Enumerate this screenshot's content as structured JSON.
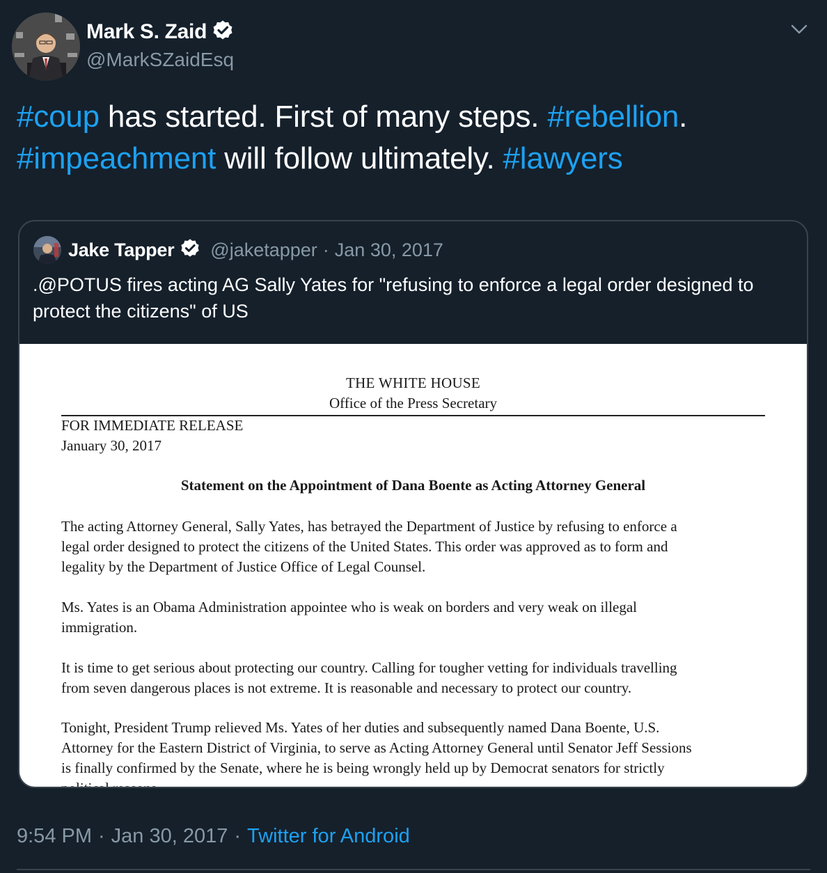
{
  "author": {
    "name": "Mark S. Zaid",
    "handle": "@MarkSZaidEsq"
  },
  "tweet": {
    "segments": [
      {
        "text": "#coup",
        "type": "hashtag"
      },
      {
        "text": " has started. First of many steps. ",
        "type": "text"
      },
      {
        "text": "#rebellion",
        "type": "hashtag"
      },
      {
        "text": ".\n",
        "type": "text"
      },
      {
        "text": "#impeachment",
        "type": "hashtag"
      },
      {
        "text": " will follow ultimately. ",
        "type": "text"
      },
      {
        "text": "#lawyers",
        "type": "hashtag"
      }
    ]
  },
  "quote": {
    "name": "Jake Tapper",
    "handle": "@jaketapper",
    "separator": "·",
    "date": "Jan 30, 2017",
    "text": ".@POTUS fires acting AG Sally Yates  for \"refusing to enforce a legal order designed to protect the citizens\" of US",
    "document": {
      "header_1": "THE WHITE HOUSE",
      "header_2": "Office of the Press Secretary",
      "release": "FOR IMMEDIATE RELEASE",
      "date": "January 30, 2017",
      "title": "Statement on the Appointment of Dana Boente as Acting Attorney General",
      "p1_lines": [
        "The acting Attorney General, Sally Yates, has betrayed the Department of Justice by refusing to enforce a",
        "legal order designed to protect the citizens of the United States. This order was approved as to form and",
        "legality by the Department of Justice Office of Legal Counsel."
      ],
      "p2_lines": [
        "Ms. Yates is an Obama Administration appointee who is weak on borders and very weak on illegal",
        "immigration."
      ],
      "p3_lines": [
        "It is time to get serious about protecting our country. Calling for tougher vetting for individuals travelling",
        "from seven dangerous places is not extreme. It is reasonable and necessary to protect our country."
      ],
      "p4_lines": [
        "Tonight, President Trump relieved Ms. Yates of her duties and subsequently named Dana Boente, U.S.",
        "Attorney for the Eastern District of Virginia, to serve as Acting Attorney General until Senator Jeff Sessions",
        "is finally confirmed by the Senate, where he is being wrongly held up by Democrat senators for strictly",
        "political reasons."
      ]
    }
  },
  "footer": {
    "time": "9:54 PM",
    "separator": "·",
    "date": "Jan 30, 2017",
    "source": "Twitter for Android"
  },
  "colors": {
    "background": "#15202b",
    "link": "#1da1f2",
    "secondary_text": "#8899a6",
    "border": "#38444d",
    "verified": "#ffffff"
  },
  "icons": {
    "verified": "verified-badge-icon",
    "menu": "chevron-down-icon"
  }
}
